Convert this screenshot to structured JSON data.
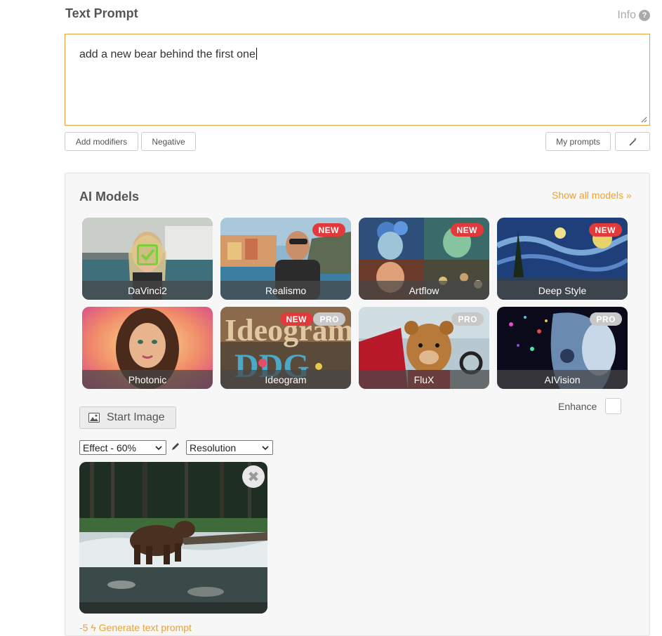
{
  "prompt": {
    "title": "Text Prompt",
    "info_label": "Info",
    "info_icon": "question-circle-icon",
    "value": "add a new bear behind the first one"
  },
  "prompt_buttons": {
    "add_modifiers": "Add modifiers",
    "negative": "Negative",
    "my_prompts": "My prompts",
    "wand_icon": "magic-wand-icon"
  },
  "models": {
    "title": "AI Models",
    "show_all": "Show all models",
    "show_all_icon": "double-chevron-down-icon",
    "selected": "DaVinci2",
    "items": [
      {
        "label": "DaVinci2",
        "badges": []
      },
      {
        "label": "Realismo",
        "badges": [
          "NEW"
        ]
      },
      {
        "label": "Artflow",
        "badges": [
          "NEW"
        ]
      },
      {
        "label": "Deep Style",
        "badges": [
          "NEW"
        ]
      },
      {
        "label": "Photonic",
        "badges": []
      },
      {
        "label": "Ideogram",
        "badges": [
          "NEW",
          "PRO"
        ]
      },
      {
        "label": "FluX",
        "badges": [
          "PRO"
        ]
      },
      {
        "label": "AIVision",
        "badges": [
          "PRO"
        ]
      }
    ]
  },
  "options": {
    "start_image_label": "Start Image",
    "start_image_icon": "image-icon",
    "enhance_label": "Enhance",
    "enhance_checked": false,
    "effect_value": "Effect - 60%",
    "resolution_value": "Resolution",
    "pencil_icon": "pencil-icon"
  },
  "start_image": {
    "remove_icon": "close-icon"
  },
  "generate": {
    "text": "-5 ϟ Generate text prompt"
  },
  "colors": {
    "accent": "#e8a23a",
    "badge_new": "#e23a3a",
    "badge_pro": "#c8c8c8",
    "check_green": "#7ccf3a"
  }
}
